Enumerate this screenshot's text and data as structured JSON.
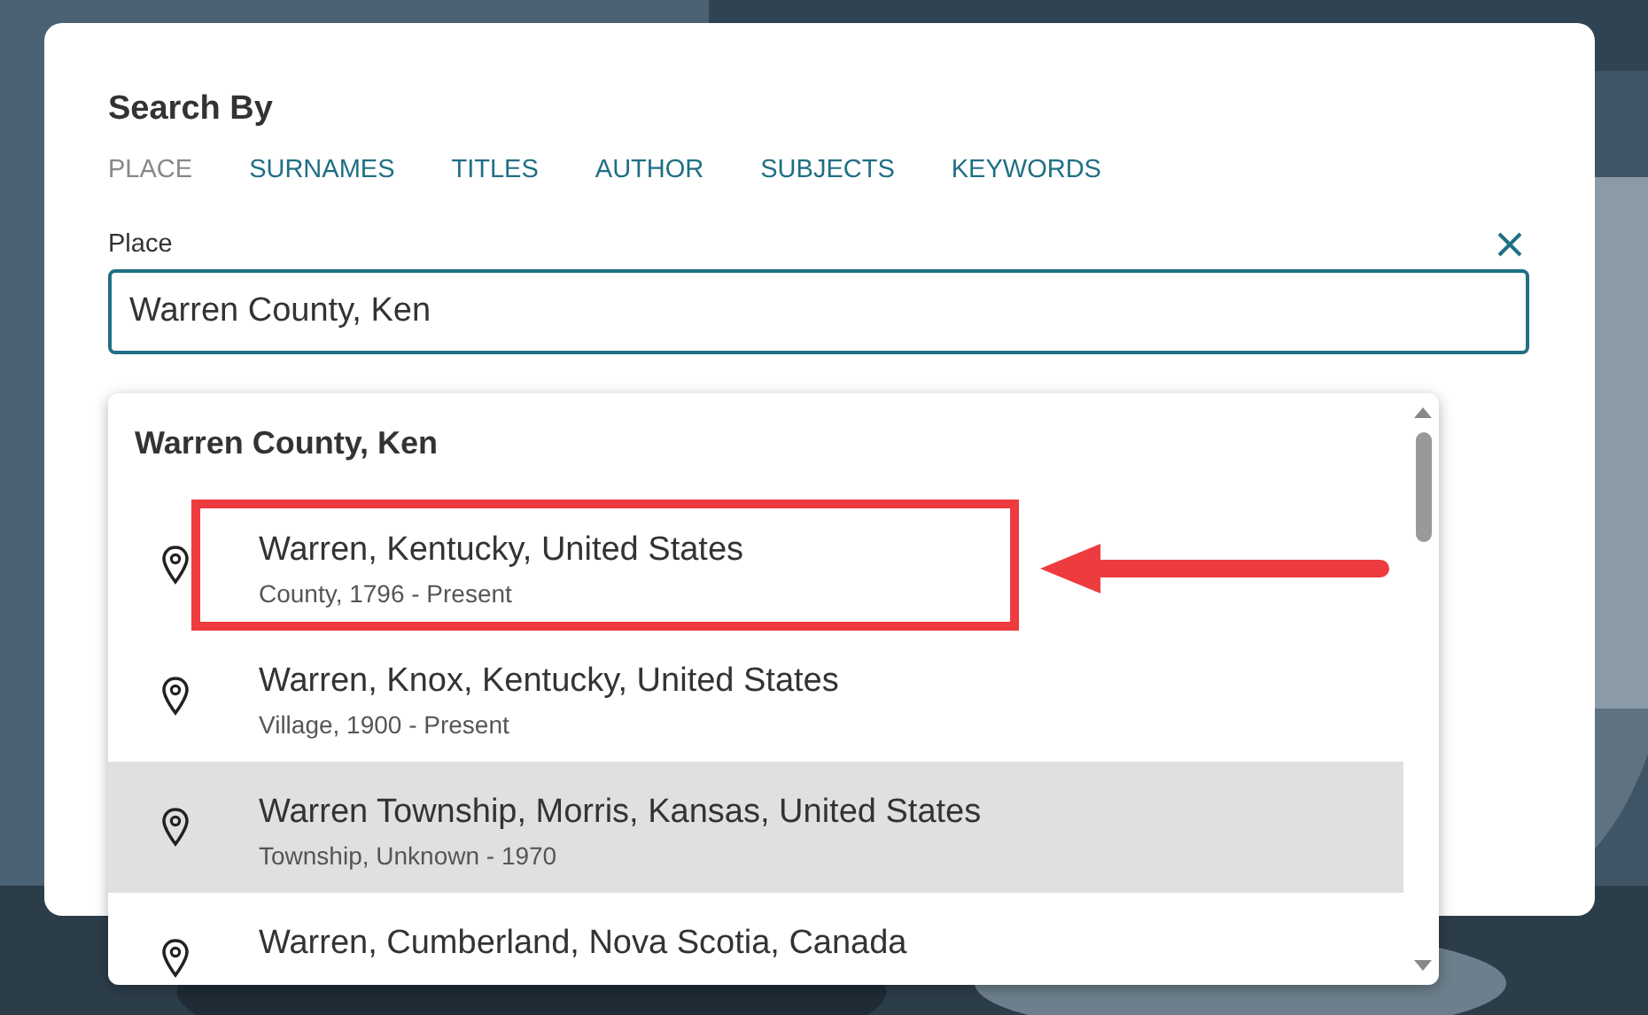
{
  "heading": "Search By",
  "tabs": [
    {
      "label": "PLACE",
      "selected": true
    },
    {
      "label": "SURNAMES",
      "selected": false
    },
    {
      "label": "TITLES",
      "selected": false
    },
    {
      "label": "AUTHOR",
      "selected": false
    },
    {
      "label": "SUBJECTS",
      "selected": false
    },
    {
      "label": "KEYWORDS",
      "selected": false
    }
  ],
  "field": {
    "label": "Place",
    "value": "Warren County, Ken"
  },
  "suggestions": {
    "header": "Warren County, Ken",
    "items": [
      {
        "title": "Warren, Kentucky, United States",
        "detail": "County, 1796 - Present",
        "highlighted": false,
        "annotated": true
      },
      {
        "title": "Warren, Knox, Kentucky, United States",
        "detail": "Village, 1900 - Present",
        "highlighted": false
      },
      {
        "title": "Warren Township, Morris, Kansas, United States",
        "detail": "Township, Unknown - 1970",
        "highlighted": true
      },
      {
        "title": "Warren, Cumberland, Nova Scotia, Canada",
        "highlighted": false
      }
    ]
  }
}
